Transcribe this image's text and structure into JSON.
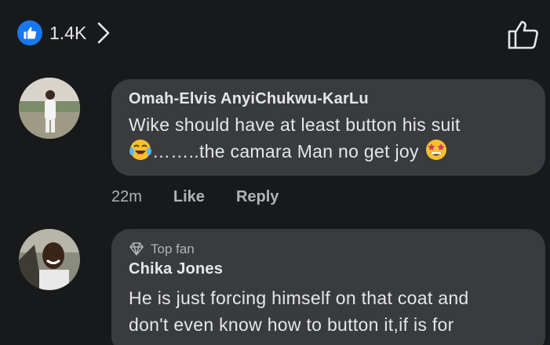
{
  "reactions": {
    "count": "1.4K"
  },
  "comments": [
    {
      "author": "Omah-Elvis AnyiChukwu-KarLu",
      "line1": "Wike should have at least button his suit",
      "line2": "……..the camara Man no get joy",
      "time": "22m",
      "like_label": "Like",
      "reply_label": "Reply"
    },
    {
      "badge": "Top fan",
      "author": "Chika Jones",
      "line1": "He is just forcing himself on that coat and",
      "line2": "don't even know how to button it,if is for"
    }
  ],
  "icons": {
    "like_badge": "like-thumb-icon",
    "chevron": "chevron-right-icon",
    "like_outline": "thumb-up-outline-icon",
    "top_fan": "diamond-icon",
    "emoji1": "laughing-tears-emoji",
    "emoji2": "star-struck-emoji"
  },
  "colors": {
    "background": "#18191a",
    "bubble": "#3a3b3c",
    "accent": "#1877f2",
    "secondary_text": "#b0b3b8"
  }
}
